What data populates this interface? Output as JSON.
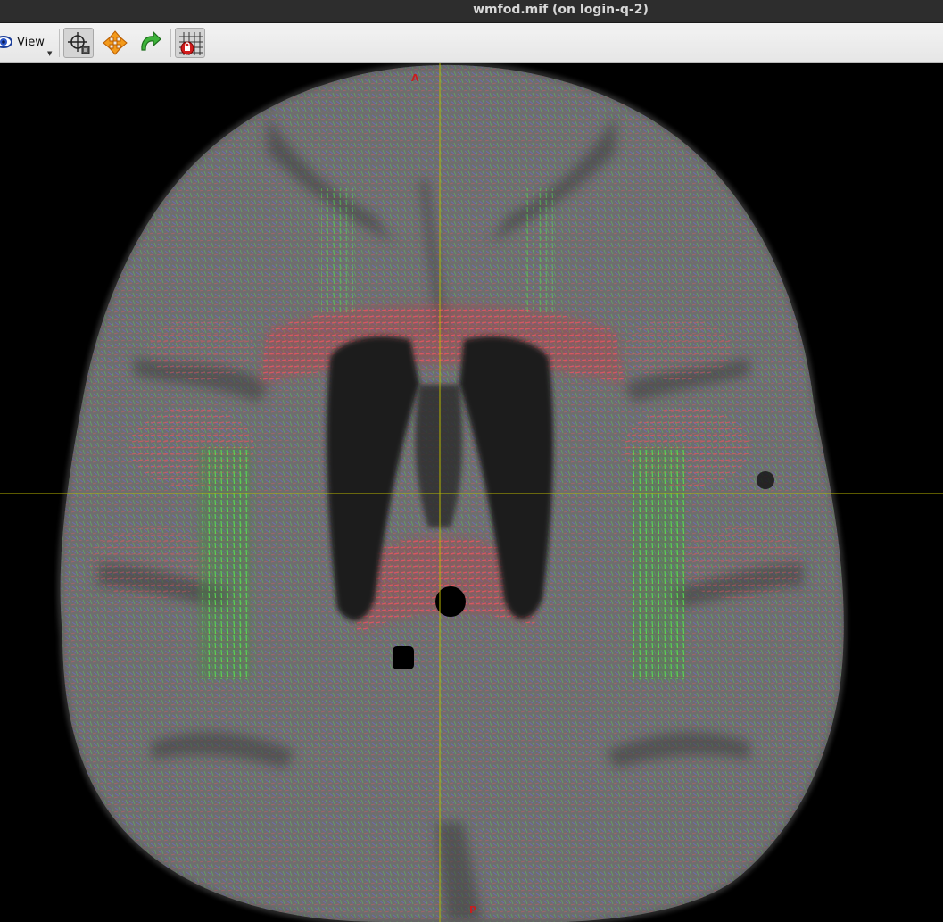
{
  "window": {
    "title": "wmfod.mif (on login-q-2)"
  },
  "toolbar": {
    "view_label": "View",
    "tools": [
      {
        "name": "focus-tool",
        "icon": "crosshair-icon",
        "pressed": true
      },
      {
        "name": "move-tool",
        "icon": "move-arrows-icon",
        "pressed": false
      },
      {
        "name": "rotate-tool",
        "icon": "rotate-arrow-icon",
        "pressed": false
      },
      {
        "name": "lock-grid-tool",
        "icon": "grid-lock-icon",
        "pressed": true
      }
    ]
  },
  "viewer": {
    "orientation_top": "A",
    "orientation_bottom": "P",
    "crosshair_color": "#b7b400",
    "background_color": "#000000",
    "tissue_color": "#7a7a7a",
    "fod_colors": {
      "left_right": "#e0404e",
      "anterior_posterior": "#4ed24a",
      "superior_inferior": "#5a5ae0"
    }
  }
}
